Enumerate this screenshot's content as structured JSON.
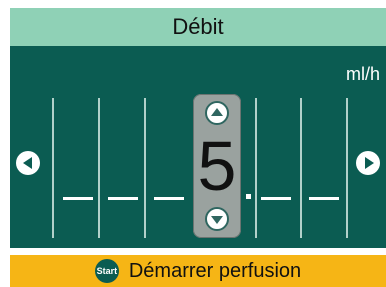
{
  "header": {
    "title": "Débit"
  },
  "rate": {
    "unit": "ml/h",
    "current_digit": "5"
  },
  "footer": {
    "start_badge": "Start",
    "action_label": "Démarrer perfusion"
  },
  "icons": {
    "left": "chevron-left-icon",
    "right": "chevron-right-icon",
    "up": "chevron-up-icon",
    "down": "chevron-down-icon",
    "start": "start-icon"
  },
  "colors": {
    "header_bg": "#8fd1b6",
    "panel_bg": "#0b5c52",
    "selected_digit_bg": "#9aa29f",
    "footer_bg": "#f6b515"
  }
}
